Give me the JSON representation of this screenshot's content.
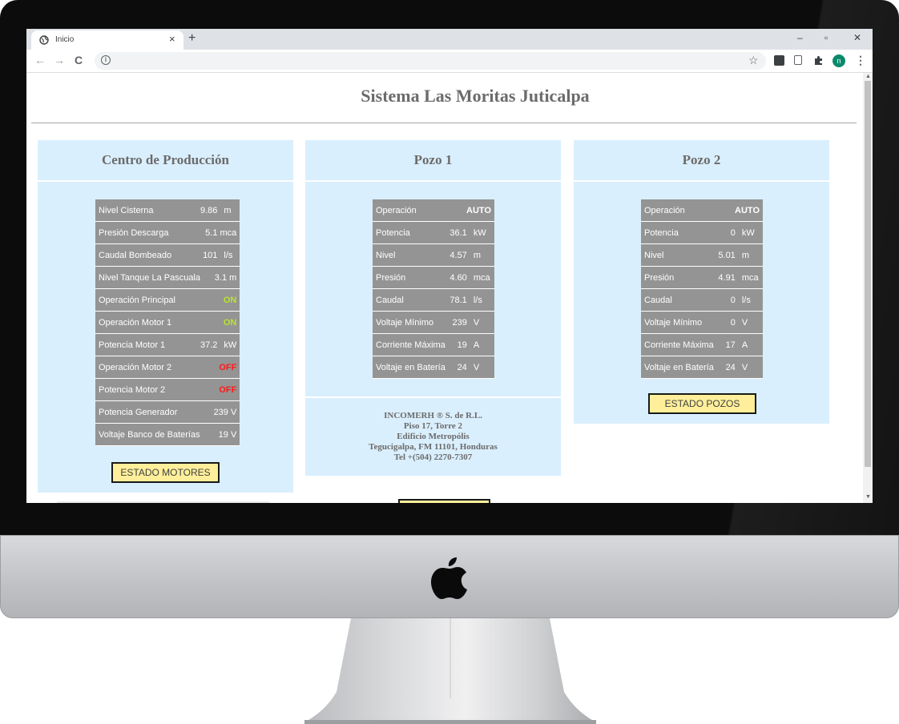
{
  "browser": {
    "tab_title": "Inicio",
    "tab_close": "×",
    "new_tab": "+",
    "win_min": "–",
    "win_max": "▫",
    "win_close": "✕",
    "back": "←",
    "forward": "→",
    "reload": "C",
    "info": "i",
    "star": "☆",
    "profile_initial": "n",
    "menu": "⋮"
  },
  "page": {
    "title": "Sistema Las Moritas Juticalpa"
  },
  "centro": {
    "heading": "Centro de Producción",
    "rows": [
      {
        "label": "Nivel Cisterna",
        "value": "9.86",
        "unit": "m"
      },
      {
        "label": "Presión Descarga",
        "value": "5.1 mca",
        "unit": ""
      },
      {
        "label": "Caudal Bombeado",
        "value": "101",
        "unit": "l/s"
      },
      {
        "label": "Nivel Tanque La Pascuala",
        "value": "3.1 m",
        "unit": ""
      },
      {
        "label": "Operación Principal",
        "value": "ON",
        "unit": ""
      },
      {
        "label": "Operación Motor 1",
        "value": "ON",
        "unit": ""
      },
      {
        "label": "Potencia Motor 1",
        "value": "37.2",
        "unit": "kW"
      },
      {
        "label": "Operación Motor 2",
        "value": "OFF",
        "unit": ""
      },
      {
        "label": "Potencia Motor 2",
        "value": "OFF",
        "unit": ""
      },
      {
        "label": "Potencia Generador",
        "value": "239 V",
        "unit": ""
      },
      {
        "label": "Voltaje Banco de Baterías",
        "value": "19 V",
        "unit": ""
      }
    ],
    "button": "ESTADO MOTORES"
  },
  "pozo1": {
    "heading": "Pozo 1",
    "rows": [
      {
        "label": "Operación",
        "value": "AUTO",
        "unit": ""
      },
      {
        "label": "Potencia",
        "value": "36.1",
        "unit": "kW"
      },
      {
        "label": "Nivel",
        "value": "4.57",
        "unit": "m"
      },
      {
        "label": "Presión",
        "value": "4.60",
        "unit": "mca"
      },
      {
        "label": "Caudal",
        "value": "78.1",
        "unit": "l/s"
      },
      {
        "label": "Voltaje Mínimo",
        "value": "239",
        "unit": "V"
      },
      {
        "label": "Corriente Máxima",
        "value": "19",
        "unit": "A"
      },
      {
        "label": "Voltaje en Batería",
        "value": "24",
        "unit": "V"
      }
    ],
    "company": {
      "line1": "INCOMERH ® S. de R.L.",
      "line2": "Piso 17, Torre 2",
      "line3": "Edificio Metropólis",
      "line4": "Tegucigalpa, FM 11101, Honduras",
      "line5": "Tel +(504) 2270-7307"
    }
  },
  "pozo2": {
    "heading": "Pozo 2",
    "rows": [
      {
        "label": "Operación",
        "value": "AUTO",
        "unit": ""
      },
      {
        "label": "Potencia",
        "value": "0",
        "unit": "kW"
      },
      {
        "label": "Nivel",
        "value": "5.01",
        "unit": "m"
      },
      {
        "label": "Presión",
        "value": "4.91",
        "unit": "mca"
      },
      {
        "label": "Caudal",
        "value": "0",
        "unit": "l/s"
      },
      {
        "label": "Voltaje Mínimo",
        "value": "0",
        "unit": "V"
      },
      {
        "label": "Corriente Máxima",
        "value": "17",
        "unit": "A"
      },
      {
        "label": "Voltaje en Batería",
        "value": "24",
        "unit": "V"
      }
    ],
    "button": "ESTADO POZOS"
  },
  "colors": {
    "panel_bg": "#daeffd",
    "cell_bg": "#949494",
    "on": "#b8e62a",
    "off": "#ff1a1a",
    "button_bg": "#ffef9a"
  }
}
